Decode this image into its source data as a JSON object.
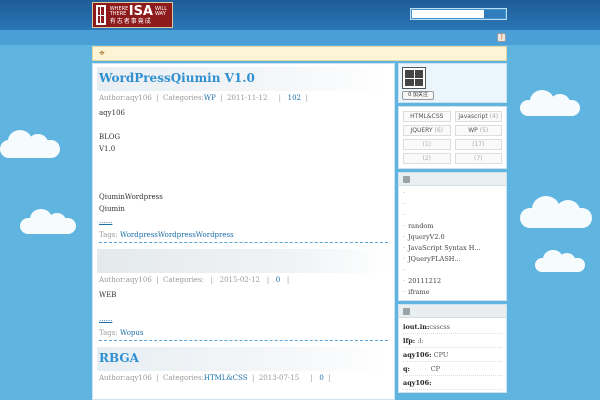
{
  "header": {
    "logo_small_text_1": "WHERE THERE",
    "logo_big_text": "ISA",
    "logo_small_text_2": "WILL WAY",
    "logo_cn_text": "有志者事竟成",
    "search_placeholder": ""
  },
  "icons": {
    "rss": "rss-icon",
    "notice": "notice-icon"
  },
  "posts": [
    {
      "title": "WordPressQiumin V1.0",
      "author": "Author:aqy106",
      "sep1": "|",
      "categories_label": "Categories:",
      "category": "WP",
      "sep2": "|",
      "date": "2011-11-12",
      "sep3": "|",
      "comments": "102",
      "sep4": "|",
      "body": [
        "aqy106",
        "",
        "BLOG",
        "V1.0",
        "",
        "",
        "",
        "QiuminWordpress",
        "Qiumin"
      ],
      "more": "......",
      "tags_label": "Tags:",
      "tags": "WordpressWordpressWordpress"
    },
    {
      "title": "",
      "author": "Author:aqy106",
      "sep1": "|",
      "categories_label": "Categories:",
      "category": "",
      "sep2": "|",
      "date": "2015-02-12",
      "sep3": "|",
      "comments": "0",
      "sep4": "|",
      "body": [
        "WEB"
      ],
      "more": "......",
      "tags_label": "Tags:",
      "tags": "Wopus"
    },
    {
      "title": "RBGA",
      "author": "Author:aqy106",
      "sep1": "|",
      "categories_label": "Categories:",
      "category": "HTML&CSS",
      "sep2": "|",
      "date": "2013-07-15",
      "sep3": "|",
      "comments": "0",
      "sep4": "|"
    }
  ],
  "sidebar": {
    "follow_label": "0 加关注",
    "tags": [
      {
        "name": "HTML&CSS",
        "count": ""
      },
      {
        "name": "javascript",
        "count": "(4)"
      },
      {
        "name": "JQUERY",
        "count": "(6)"
      },
      {
        "name": "WP",
        "count": "(5)"
      },
      {
        "name": "",
        "count": "(1)"
      },
      {
        "name": "",
        "count": "(17)"
      },
      {
        "name": "",
        "count": "(2)"
      },
      {
        "name": "",
        "count": "(7)"
      }
    ],
    "recent": [
      "",
      "",
      "",
      "random",
      "JqueryV2.0",
      "JavaScript Syntax H...",
      "JQueryFLASH...",
      "",
      "20111212",
      "iframe"
    ],
    "comments": [
      {
        "author": "iout.in:",
        "text": "csscss"
      },
      {
        "author": "lfp:",
        "text": ":l:"
      },
      {
        "author": "aqy106:",
        "text": "CPU"
      },
      {
        "author": "q:",
        "text": "CP"
      },
      {
        "author": "aqy106:",
        "text": ""
      }
    ]
  }
}
